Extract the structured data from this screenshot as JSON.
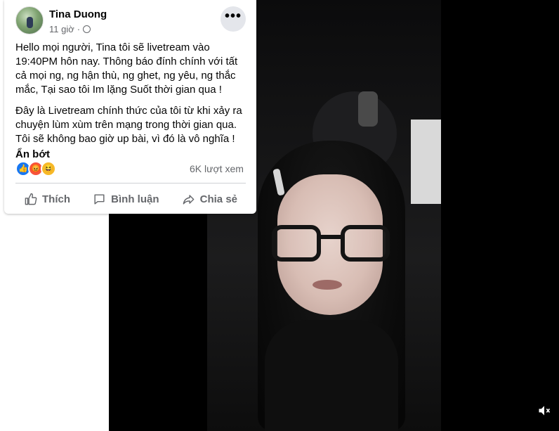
{
  "post": {
    "author": "Tina Duong",
    "time": "11 giờ",
    "privacy_icon": "globe-icon",
    "more_label": "•••",
    "paragraphs": [
      "Hello mọi người, Tina tôi sẽ livetream vào 19:40PM hôn nay. Thông báo đính chính với tất cả mọi ng, ng hận thù, ng ghet, ng yêu, ng thắc mắc, Tại sao tôi Im lặng Suốt thời gian qua !",
      "Đây là Livetream chính thức của tôi từ khi xảy ra chuyện lùm xùm trên mạng trong thời gian qua. Tôi sẽ không bao giờ up bài, vì đó là vô nghĩa !"
    ],
    "see_less": "Ẩn bớt",
    "reactions": [
      "like-icon",
      "angry-icon",
      "haha-icon"
    ],
    "views": "6K lượt xem",
    "actions": {
      "like": "Thích",
      "comment": "Bình luận",
      "share": "Chia sẻ"
    }
  },
  "video": {
    "mute_icon": "speaker-muted-icon"
  },
  "colors": {
    "text_primary": "#050505",
    "text_secondary": "#65676b",
    "like_blue": "#1877f2"
  }
}
